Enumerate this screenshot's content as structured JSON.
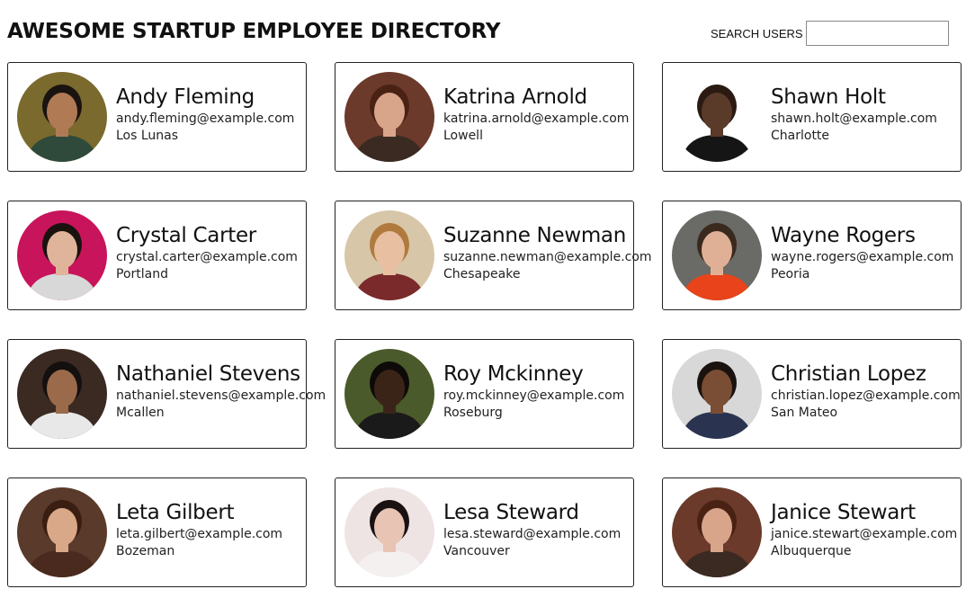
{
  "header": {
    "title": "AWESOME STARTUP EMPLOYEE DIRECTORY",
    "search_label": "SEARCH USERS",
    "search_value": ""
  },
  "employees": [
    {
      "name": "Andy Fleming",
      "email": "andy.fleming@example.com",
      "city": "Los Lunas",
      "avatar": {
        "bg": "#7a6a2e",
        "skin": "#b07a55",
        "hair": "#1a1410",
        "shirt": "#2f4a3a"
      }
    },
    {
      "name": "Katrina Arnold",
      "email": "katrina.arnold@example.com",
      "city": "Lowell",
      "avatar": {
        "bg": "#6b3a2a",
        "skin": "#d9a58a",
        "hair": "#4a2214",
        "shirt": "#3a2a22"
      }
    },
    {
      "name": "Shawn Holt",
      "email": "shawn.holt@example.com",
      "city": "Charlotte",
      "avatar": {
        "bg": "#ffffff",
        "skin": "#5a3a28",
        "hair": "#2a1a12",
        "shirt": "#151515"
      }
    },
    {
      "name": "Crystal Carter",
      "email": "crystal.carter@example.com",
      "city": "Portland",
      "avatar": {
        "bg": "#c8145a",
        "skin": "#e0b49a",
        "hair": "#1a120e",
        "shirt": "#d8d8d8"
      }
    },
    {
      "name": "Suzanne Newman",
      "email": "suzanne.newman@example.com",
      "city": "Chesapeake",
      "avatar": {
        "bg": "#d8c6a8",
        "skin": "#e8bfa0",
        "hair": "#b07a3e",
        "shirt": "#7a2a2a"
      }
    },
    {
      "name": "Wayne Rogers",
      "email": "wayne.rogers@example.com",
      "city": "Peoria",
      "avatar": {
        "bg": "#6a6a66",
        "skin": "#e0b096",
        "hair": "#3a2a1e",
        "shirt": "#e8431a"
      }
    },
    {
      "name": "Nathaniel Stevens",
      "email": "nathaniel.stevens@example.com",
      "city": "Mcallen",
      "avatar": {
        "bg": "#3a2a22",
        "skin": "#9a6a4a",
        "hair": "#151010",
        "shirt": "#e8e8e8"
      }
    },
    {
      "name": "Roy Mckinney",
      "email": "roy.mckinney@example.com",
      "city": "Roseburg",
      "avatar": {
        "bg": "#4a5a2a",
        "skin": "#3a2418",
        "hair": "#0e0a08",
        "shirt": "#1a1a1a"
      }
    },
    {
      "name": "Christian Lopez",
      "email": "christian.lopez@example.com",
      "city": "San Mateo",
      "avatar": {
        "bg": "#d8d8d8",
        "skin": "#7a4e34",
        "hair": "#1a120e",
        "shirt": "#2a3450"
      }
    },
    {
      "name": "Leta Gilbert",
      "email": "leta.gilbert@example.com",
      "city": "Bozeman",
      "avatar": {
        "bg": "#5a3a2a",
        "skin": "#d8a888",
        "hair": "#3a1e12",
        "shirt": "#4a2a1e"
      }
    },
    {
      "name": "Lesa Steward",
      "email": "lesa.steward@example.com",
      "city": "Vancouver",
      "avatar": {
        "bg": "#efe4e4",
        "skin": "#e8c4b4",
        "hair": "#1a1212",
        "shirt": "#f4f0f0"
      }
    },
    {
      "name": "Janice Stewart",
      "email": "janice.stewart@example.com",
      "city": "Albuquerque",
      "avatar": {
        "bg": "#6b3a2a",
        "skin": "#d9a58a",
        "hair": "#4a2214",
        "shirt": "#3a2a22"
      }
    }
  ]
}
